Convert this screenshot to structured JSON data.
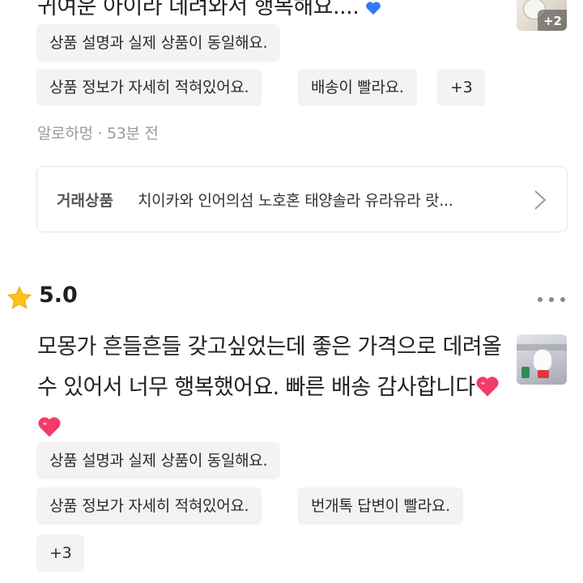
{
  "review_top": {
    "text_cut": "귀여운 아이라 데려와서 행복해요....",
    "photo_count": "+2",
    "chips": [
      "상품 설명과 실제 상품이 동일해요.",
      "상품 정보가 자세히 적혀있어요.",
      "배송이 빨라요.",
      "+3"
    ],
    "meta": "알로하멍 · 53분 전",
    "product": {
      "label": "거래상품",
      "name": "치이카와 인어의섬 노호혼 태양솔라 유라유라 랏..."
    }
  },
  "review_second": {
    "rating": "5.0",
    "body_line1": "모몽가 흔들흔들 갖고싶었는데 좋은 가격으로 데려올",
    "body_line2": "수 있어서 너무 행복했어요. 빠른 배송 감사합니다",
    "chips": [
      "상품 설명과 실제 상품이 동일해요.",
      "상품 정보가 자세히 적혀있어요.",
      "번개톡 답변이 빨라요.",
      "+3"
    ]
  },
  "colors": {
    "chip_bg": "#f2f3f5",
    "meta_gray": "#9a9a9a",
    "star": "#ffc21a",
    "heart_pink": "#f23b68",
    "heart_blue": "#2f7cf6"
  },
  "icons": [
    "star-icon",
    "more-icon",
    "chevron-right-icon",
    "heart-icon"
  ]
}
